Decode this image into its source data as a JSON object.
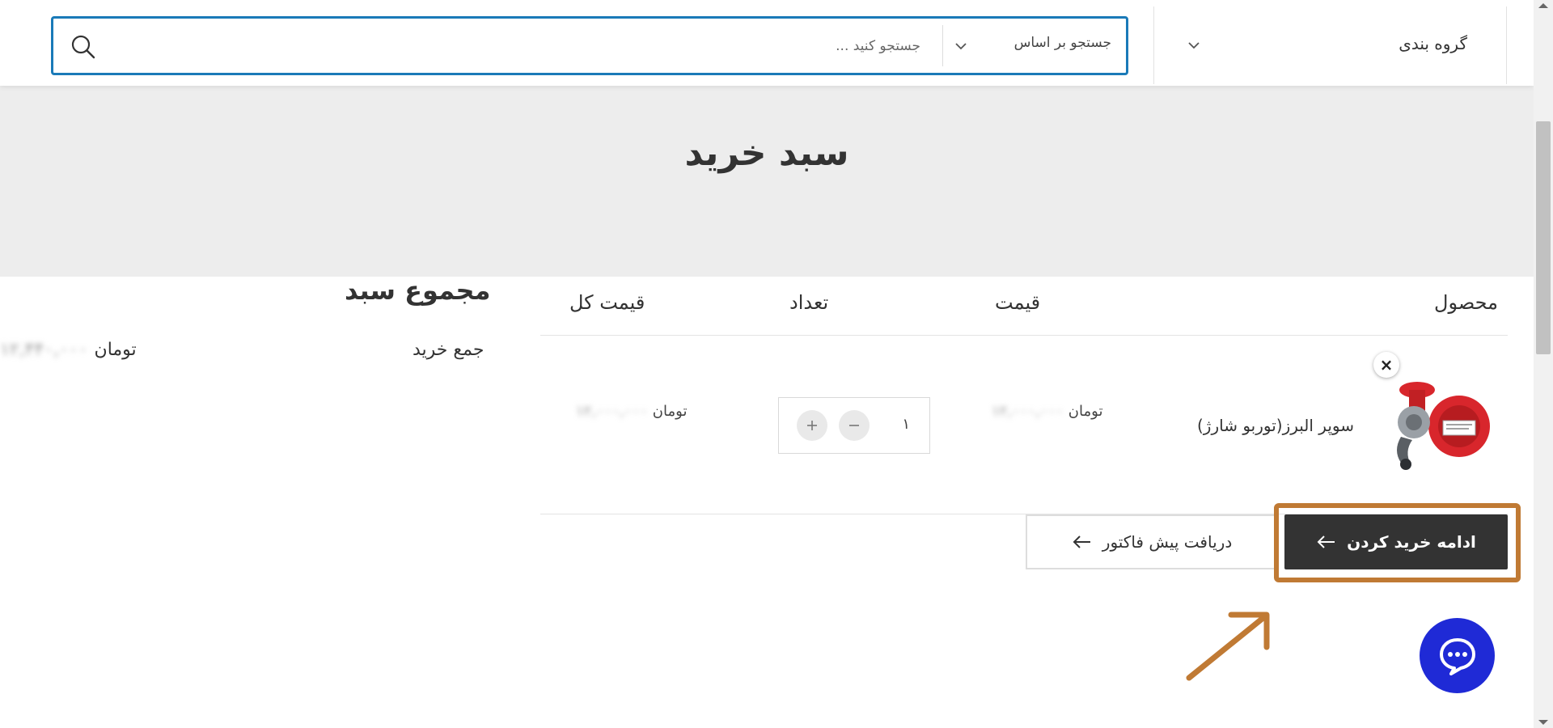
{
  "header": {
    "category_label": "گروه بندی",
    "search_by_label": "جستجو بر اساس",
    "search_placeholder": "جستجو کنید ..."
  },
  "banner": {
    "title": "سبد خرید"
  },
  "cart": {
    "columns": {
      "product": "محصول",
      "price": "قیمت",
      "quantity": "تعداد",
      "total": "قیمت کل"
    },
    "items": [
      {
        "name": "سوپر البرز(توربو شارژ)",
        "price_amount": "۱۲,۰۰۰,۰۰۰",
        "price_currency": "تومان",
        "quantity": "۱",
        "total_amount": "۱۲,۰۰۰,۰۰۰",
        "total_currency": "تومان",
        "remove_symbol": "×",
        "image_icon": "turbocharger-image"
      }
    ]
  },
  "totals": {
    "title": "مجموع سبد",
    "subtotal_label": "جمع خرید",
    "subtotal_amount": "۱۲,۴۴۰,۰۰۰",
    "subtotal_currency": "تومان"
  },
  "actions": {
    "continue_label": "ادامه خرید کردن",
    "invoice_label": "دریافت پیش فاکتور"
  },
  "colors": {
    "search_border": "#1a7ab8",
    "primary_button": "#333333",
    "annotation": "#c07a34",
    "chat": "#1f2ad6",
    "product_red": "#d8262c"
  }
}
